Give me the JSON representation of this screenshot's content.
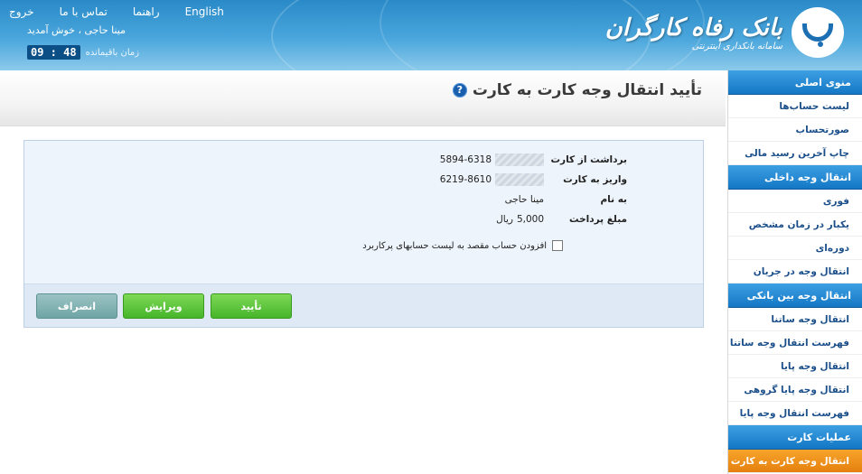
{
  "header": {
    "links": [
      "خروج",
      "تماس با ما",
      "راهنما",
      "English"
    ],
    "welcome": "مینا حاجی ، خوش آمدید",
    "timer_label": "زمان باقیمانده",
    "timer_value": "09 : 48",
    "brand_title": "بانک رفاه کارگران",
    "brand_subtitle": "سامانه بانکداری اینترنتی"
  },
  "page": {
    "title": "تأیید انتقال وجه کارت به کارت",
    "help_icon": "?"
  },
  "form": {
    "rows": [
      {
        "label": "برداشت از کارت",
        "value": "5894-6318",
        "masked": true
      },
      {
        "label": "واریز به کارت",
        "value": "6219-8610",
        "masked": true
      },
      {
        "label": "به نام",
        "value": "مینا حاجی",
        "masked": false
      },
      {
        "label": "مبلغ پرداخت",
        "value": "5,000",
        "unit": "ریال",
        "masked": false
      }
    ],
    "checkbox_label": "افزودن حساب مقصد به لیست حسابهای پرکاربرد",
    "buttons": {
      "confirm": "تأیید",
      "edit": "ویرایش",
      "cancel": "انصراف"
    }
  },
  "sidebar": {
    "sections": [
      {
        "title": "منوی اصلی",
        "items": [
          "لیست حساب‌ها",
          "صورتحساب",
          "چاپ آخرین رسید مالی"
        ]
      },
      {
        "title": "انتقال وجه داخلی",
        "items": [
          "فوری",
          "یکبار در زمان مشخص",
          "دوره‌ای",
          "انتقال وجه در جریان"
        ]
      },
      {
        "title": "انتقال وجه بین بانکی",
        "items": [
          "انتقال وجه ساتنا",
          "فهرست انتقال وجه ساتنا",
          "انتقال وجه پایا",
          "انتقال وجه پایا گروهی",
          "فهرست انتقال وجه پایا"
        ]
      },
      {
        "title": "عملیات کارت",
        "items": [
          "انتقال وجه کارت به کارت"
        ]
      }
    ]
  },
  "colors": {
    "header_blue": "#2a8ac8",
    "menu_blue": "#1477c5",
    "active_orange": "#e5800e",
    "button_green": "#46b52a",
    "button_gray": "#6fa5a5"
  }
}
